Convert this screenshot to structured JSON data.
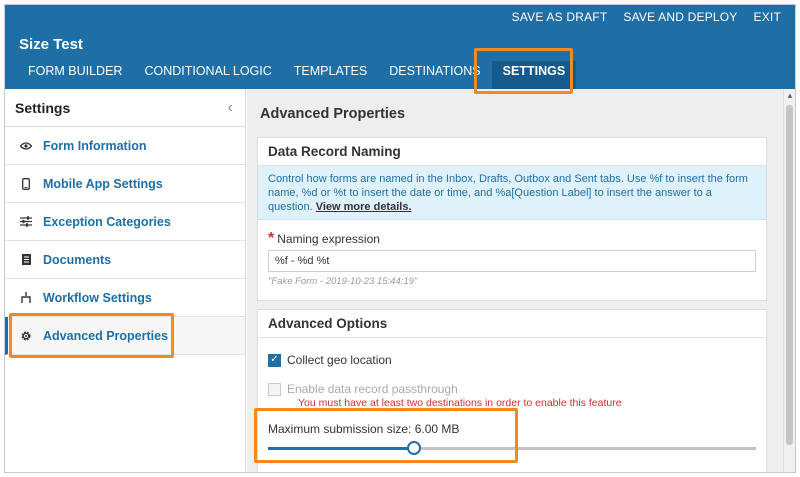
{
  "header": {
    "actions": [
      "SAVE AS DRAFT",
      "SAVE AND DEPLOY",
      "EXIT"
    ],
    "title": "Size Test",
    "tabs": [
      "FORM BUILDER",
      "CONDITIONAL LOGIC",
      "TEMPLATES",
      "DESTINATIONS",
      "SETTINGS"
    ],
    "active_tab": "SETTINGS"
  },
  "sidebar": {
    "title": "Settings",
    "collapse_glyph": "‹",
    "items": [
      {
        "label": "Form Information",
        "icon": "eye-icon"
      },
      {
        "label": "Mobile App Settings",
        "icon": "mobile-icon"
      },
      {
        "label": "Exception Categories",
        "icon": "sliders-icon"
      },
      {
        "label": "Documents",
        "icon": "document-icon"
      },
      {
        "label": "Workflow Settings",
        "icon": "workflow-icon"
      },
      {
        "label": "Advanced Properties",
        "icon": "gear-icon",
        "active": true
      }
    ]
  },
  "main": {
    "title": "Advanced Properties",
    "naming": {
      "heading": "Data Record Naming",
      "info": "Control how forms are named in the Inbox, Drafts, Outbox and Sent tabs. Use %f to insert the form name, %d or %t to insert the date or time, and %a[Question Label] to insert the answer to a question.",
      "info_link": "View more details.",
      "required_mark": "*",
      "expression_label": "Naming expression",
      "expression_value": "%f - %d %t",
      "preview": "\"Fake Form - 2019-10-23 15:44:19\""
    },
    "options": {
      "heading": "Advanced Options",
      "geo_label": "Collect geo location",
      "geo_checked": true,
      "passthrough_label": "Enable data record passthrough",
      "passthrough_checked": false,
      "passthrough_warning": "You must have at least two destinations in order to enable this feature",
      "max_size_label": "Maximum submission size: 6.00 MB",
      "max_size_fraction": 0.3
    }
  },
  "colors": {
    "brand": "#1f6fa6",
    "callout": "#f28a1e",
    "warning": "#d32f2f"
  }
}
